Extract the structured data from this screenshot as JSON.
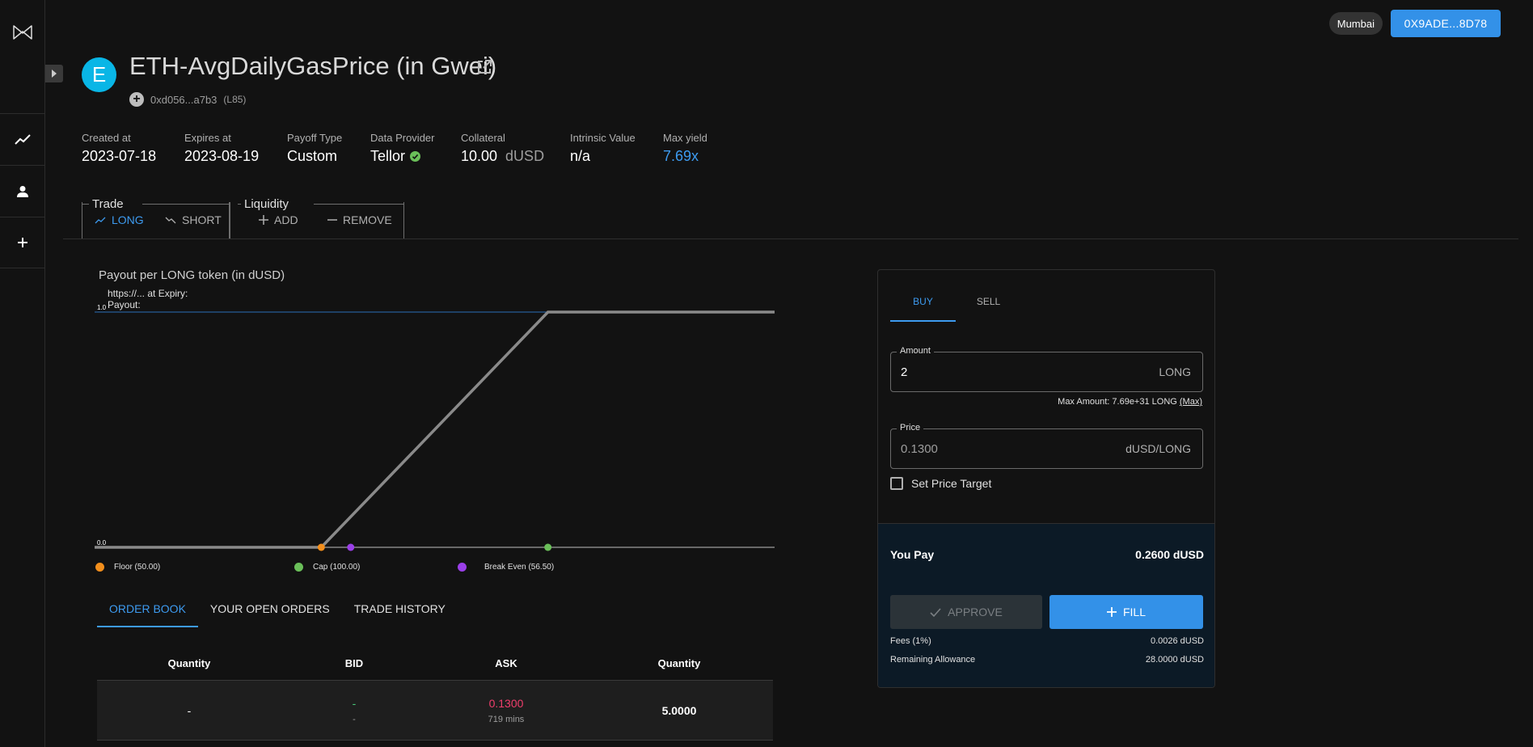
{
  "network": "Mumbai",
  "wallet": "0X9ADE...8D78",
  "pool": {
    "avatar_letter": "E",
    "title": "ETH-AvgDailyGasPrice (in Gwei)",
    "address": "0xd056...a7b3",
    "id": "(L85)"
  },
  "stats": [
    {
      "label": "Created at",
      "value": "2023-07-18"
    },
    {
      "label": "Expires at",
      "value": "2023-08-19"
    },
    {
      "label": "Payoff Type",
      "value": "Custom"
    },
    {
      "label": "Data Provider",
      "value": "Tellor"
    },
    {
      "label": "Collateral",
      "value": "10.00",
      "unit": "dUSD"
    },
    {
      "label": "Intrinsic Value",
      "value": "n/a"
    },
    {
      "label": "Max yield",
      "value": "7.69x"
    }
  ],
  "groups": {
    "trade": {
      "legend": "Trade",
      "long": "LONG",
      "short": "SHORT"
    },
    "liquidity": {
      "legend": "Liquidity",
      "add": "ADD",
      "remove": "REMOVE"
    }
  },
  "chart": {
    "title": "Payout per LONG token (in dUSD)",
    "tooltip_line1": "https://... at Expiry:",
    "tooltip_line2": "Payout:",
    "y_top_label": "1.0",
    "y_bottom_label": "0.0",
    "legend": [
      {
        "label": "Floor (50.00)",
        "color": "#f28e1c"
      },
      {
        "label": "Cap (100.00)",
        "color": "#6abf59"
      },
      {
        "label": "Break Even (56.50)",
        "color": "#9a3fe8"
      }
    ]
  },
  "chart_data": {
    "type": "line",
    "title": "Payout per LONG token (in dUSD)",
    "xlabel": "",
    "ylabel": "",
    "ylim": [
      0,
      1.0
    ],
    "x": [
      0,
      50,
      100,
      150
    ],
    "series": [
      {
        "values": [
          0,
          0,
          1.0,
          1.0
        ]
      }
    ],
    "markers": [
      {
        "label": "Floor (50.00)",
        "x": 50,
        "y": 0
      },
      {
        "label": "Cap (100.00)",
        "x": 100,
        "y": 0
      },
      {
        "label": "Break Even (56.50)",
        "x": 56.5,
        "y": 0
      }
    ]
  },
  "orderbook": {
    "tabs": [
      "ORDER BOOK",
      "YOUR OPEN ORDERS",
      "TRADE HISTORY"
    ],
    "columns": [
      "Quantity",
      "BID",
      "ASK",
      "Quantity"
    ],
    "rows": [
      {
        "bid_qty": "-",
        "bid": "-",
        "bid_sub": "-",
        "ask": "0.1300",
        "ask_sub": "719 mins",
        "ask_qty": "5.0000"
      }
    ]
  },
  "order": {
    "tabs": {
      "buy": "BUY",
      "sell": "SELL"
    },
    "amount": {
      "label": "Amount",
      "value": "2",
      "suffix": "LONG"
    },
    "max_amount": "Max Amount: 7.69e+31 LONG",
    "max_link": "(Max)",
    "price": {
      "label": "Price",
      "value": "0.1300",
      "suffix": "dUSD/LONG"
    },
    "set_target": "Set Price Target",
    "you_pay_label": "You Pay",
    "you_pay_value": "0.2600 dUSD",
    "approve": "APPROVE",
    "fill": "FILL",
    "fees_label": "Fees (1%)",
    "fees_value": "0.0026 dUSD",
    "allowance_label": "Remaining Allowance",
    "allowance_value": "28.0000 dUSD"
  },
  "colors": {
    "accent": "#3d9bf0",
    "ask": "#f03e6c",
    "bid": "#47c97a",
    "success": "#6abf59"
  }
}
